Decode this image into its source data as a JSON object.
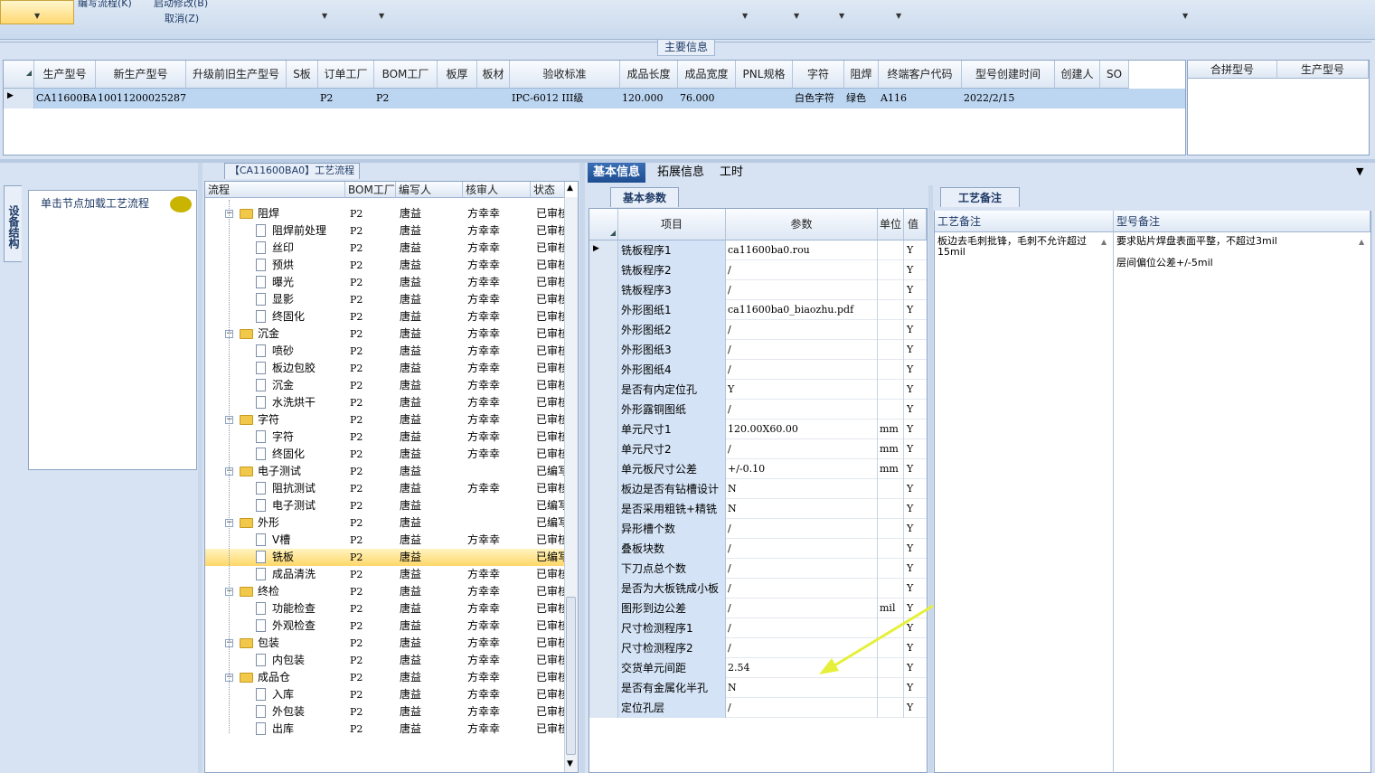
{
  "toolbar": {
    "item1": "编写流程(K)",
    "item2": "启动修改(B)",
    "item3": "取消(Z)"
  },
  "main_info": {
    "title": "主要信息",
    "columns": [
      "生产型号",
      "新生产型号",
      "升级前旧生产型号",
      "S板",
      "订单工厂",
      "BOM工厂",
      "板厚",
      "板材",
      "验收标准",
      "成品长度",
      "成品宽度",
      "PNL规格",
      "字符",
      "阻焊",
      "终端客户代码",
      "型号创建时间",
      "创建人",
      "SO"
    ],
    "row": [
      "CA11600BA0",
      "10011200025287",
      "",
      "",
      "P2",
      "P2",
      "",
      "",
      "IPC-6012 III级",
      "120.000",
      "76.000",
      "",
      "白色字符",
      "绿色",
      "A116",
      "2022/2/15",
      "",
      ""
    ],
    "merge_columns": [
      "合拼型号",
      "生产型号"
    ]
  },
  "left_panel": {
    "vertical_tab": "设备结构",
    "node_hint": "单击节点加载工艺流程"
  },
  "process": {
    "title": "【CA11600BA0】工艺流程",
    "columns": [
      "流程",
      "BOM工厂",
      "编写人",
      "核审人",
      "状态"
    ],
    "rows": [
      {
        "type": "folder",
        "name": "阻焊",
        "bom": "P2",
        "writer": "唐益",
        "reviewer": "方幸幸",
        "status": "已审核"
      },
      {
        "type": "leaf",
        "name": "阻焊前处理",
        "bom": "P2",
        "writer": "唐益",
        "reviewer": "方幸幸",
        "status": "已审核"
      },
      {
        "type": "leaf",
        "name": "丝印",
        "bom": "P2",
        "writer": "唐益",
        "reviewer": "方幸幸",
        "status": "已审核"
      },
      {
        "type": "leaf",
        "name": "预烘",
        "bom": "P2",
        "writer": "唐益",
        "reviewer": "方幸幸",
        "status": "已审核"
      },
      {
        "type": "leaf",
        "name": "曝光",
        "bom": "P2",
        "writer": "唐益",
        "reviewer": "方幸幸",
        "status": "已审核"
      },
      {
        "type": "leaf",
        "name": "显影",
        "bom": "P2",
        "writer": "唐益",
        "reviewer": "方幸幸",
        "status": "已审核"
      },
      {
        "type": "leaf",
        "name": "终固化",
        "bom": "P2",
        "writer": "唐益",
        "reviewer": "方幸幸",
        "status": "已审核"
      },
      {
        "type": "folder",
        "name": "沉金",
        "bom": "P2",
        "writer": "唐益",
        "reviewer": "方幸幸",
        "status": "已审核"
      },
      {
        "type": "leaf",
        "name": "喷砂",
        "bom": "P2",
        "writer": "唐益",
        "reviewer": "方幸幸",
        "status": "已审核"
      },
      {
        "type": "leaf",
        "name": "板边包胶",
        "bom": "P2",
        "writer": "唐益",
        "reviewer": "方幸幸",
        "status": "已审核"
      },
      {
        "type": "leaf",
        "name": "沉金",
        "bom": "P2",
        "writer": "唐益",
        "reviewer": "方幸幸",
        "status": "已审核"
      },
      {
        "type": "leaf",
        "name": "水洗烘干",
        "bom": "P2",
        "writer": "唐益",
        "reviewer": "方幸幸",
        "status": "已审核"
      },
      {
        "type": "folder",
        "name": "字符",
        "bom": "P2",
        "writer": "唐益",
        "reviewer": "方幸幸",
        "status": "已审核"
      },
      {
        "type": "leaf",
        "name": "字符",
        "bom": "P2",
        "writer": "唐益",
        "reviewer": "方幸幸",
        "status": "已审核"
      },
      {
        "type": "leaf",
        "name": "终固化",
        "bom": "P2",
        "writer": "唐益",
        "reviewer": "方幸幸",
        "status": "已审核"
      },
      {
        "type": "folder",
        "name": "电子测试",
        "bom": "P2",
        "writer": "唐益",
        "reviewer": "",
        "status": "已编写"
      },
      {
        "type": "leaf",
        "name": "阻抗测试",
        "bom": "P2",
        "writer": "唐益",
        "reviewer": "方幸幸",
        "status": "已审核"
      },
      {
        "type": "leaf",
        "name": "电子测试",
        "bom": "P2",
        "writer": "唐益",
        "reviewer": "",
        "status": "已编写"
      },
      {
        "type": "folder",
        "name": "外形",
        "bom": "P2",
        "writer": "唐益",
        "reviewer": "",
        "status": "已编写"
      },
      {
        "type": "leaf",
        "name": "V槽",
        "bom": "P2",
        "writer": "唐益",
        "reviewer": "方幸幸",
        "status": "已审核"
      },
      {
        "type": "leaf",
        "name": "铣板",
        "bom": "P2",
        "writer": "唐益",
        "reviewer": "",
        "status": "已编写",
        "selected": true
      },
      {
        "type": "leaf",
        "name": "成品清洗",
        "bom": "P2",
        "writer": "唐益",
        "reviewer": "方幸幸",
        "status": "已审核"
      },
      {
        "type": "folder",
        "name": "终检",
        "bom": "P2",
        "writer": "唐益",
        "reviewer": "方幸幸",
        "status": "已审核"
      },
      {
        "type": "leaf",
        "name": "功能检查",
        "bom": "P2",
        "writer": "唐益",
        "reviewer": "方幸幸",
        "status": "已审核"
      },
      {
        "type": "leaf",
        "name": "外观检查",
        "bom": "P2",
        "writer": "唐益",
        "reviewer": "方幸幸",
        "status": "已审核"
      },
      {
        "type": "folder",
        "name": "包装",
        "bom": "P2",
        "writer": "唐益",
        "reviewer": "方幸幸",
        "status": "已审核"
      },
      {
        "type": "leaf",
        "name": "内包装",
        "bom": "P2",
        "writer": "唐益",
        "reviewer": "方幸幸",
        "status": "已审核"
      },
      {
        "type": "folder",
        "name": "成品仓",
        "bom": "P2",
        "writer": "唐益",
        "reviewer": "方幸幸",
        "status": "已审核"
      },
      {
        "type": "leaf",
        "name": "入库",
        "bom": "P2",
        "writer": "唐益",
        "reviewer": "方幸幸",
        "status": "已审核"
      },
      {
        "type": "leaf",
        "name": "外包装",
        "bom": "P2",
        "writer": "唐益",
        "reviewer": "方幸幸",
        "status": "已审核"
      },
      {
        "type": "leaf",
        "name": "出库",
        "bom": "P2",
        "writer": "唐益",
        "reviewer": "方幸幸",
        "status": "已审核"
      }
    ]
  },
  "right_tabs": [
    "基本信息",
    "拓展信息",
    "工时"
  ],
  "basic_params": {
    "title": "基本参数",
    "columns": [
      "项目",
      "参数",
      "单位",
      "值"
    ],
    "rows": [
      {
        "item": "铣板程序1",
        "param": "ca11600ba0.rou",
        "unit": "",
        "flag": "Y",
        "current": true
      },
      {
        "item": "铣板程序2",
        "param": "/",
        "unit": "",
        "flag": "Y"
      },
      {
        "item": "铣板程序3",
        "param": "/",
        "unit": "",
        "flag": "Y"
      },
      {
        "item": "外形图纸1",
        "param": "ca11600ba0_biaozhu.pdf",
        "unit": "",
        "flag": "Y"
      },
      {
        "item": "外形图纸2",
        "param": "/",
        "unit": "",
        "flag": "Y"
      },
      {
        "item": "外形图纸3",
        "param": "/",
        "unit": "",
        "flag": "Y"
      },
      {
        "item": "外形图纸4",
        "param": "/",
        "unit": "",
        "flag": "Y"
      },
      {
        "item": "是否有内定位孔",
        "param": "Y",
        "unit": "",
        "flag": "Y"
      },
      {
        "item": "外形露铜图纸",
        "param": "/",
        "unit": "",
        "flag": "Y"
      },
      {
        "item": "单元尺寸1",
        "param": "120.00X60.00",
        "unit": "mm",
        "flag": "Y"
      },
      {
        "item": "单元尺寸2",
        "param": "/",
        "unit": "mm",
        "flag": "Y"
      },
      {
        "item": "单元板尺寸公差",
        "param": "+/-0.10",
        "unit": "mm",
        "flag": "Y"
      },
      {
        "item": "板边是否有钻槽设计",
        "param": "N",
        "unit": "",
        "flag": "Y"
      },
      {
        "item": "是否采用粗铣+精铣",
        "param": "N",
        "unit": "",
        "flag": "Y"
      },
      {
        "item": "异形槽个数",
        "param": "/",
        "unit": "",
        "flag": "Y"
      },
      {
        "item": "叠板块数",
        "param": "/",
        "unit": "",
        "flag": "Y"
      },
      {
        "item": "下刀点总个数",
        "param": "/",
        "unit": "",
        "flag": "Y"
      },
      {
        "item": "是否为大板铣成小板",
        "param": "/",
        "unit": "",
        "flag": "Y"
      },
      {
        "item": "图形到边公差",
        "param": "/",
        "unit": "mil",
        "flag": "Y"
      },
      {
        "item": "尺寸检测程序1",
        "param": "/",
        "unit": "",
        "flag": "Y"
      },
      {
        "item": "尺寸检测程序2",
        "param": "/",
        "unit": "",
        "flag": "Y"
      },
      {
        "item": "交货单元间距",
        "param": "2.54",
        "unit": "",
        "flag": "Y"
      },
      {
        "item": "是否有金属化半孔",
        "param": "N",
        "unit": "",
        "flag": "Y"
      },
      {
        "item": "定位孔层",
        "param": "/",
        "unit": "",
        "flag": "Y"
      }
    ]
  },
  "process_notes": {
    "title": "工艺备注",
    "col1": "工艺备注",
    "col2": "型号备注",
    "note1": "板边去毛刺批锋，毛刺不允许超过15mil",
    "note2_line1": "要求贴片焊盘表面平整，不超过3mil",
    "note2_line2": "层间偏位公差+/-5mil"
  },
  "colors": {
    "accent": "#1e4e92",
    "selection": "#ffd76a",
    "annotation_arrow": "#e6f03a"
  }
}
